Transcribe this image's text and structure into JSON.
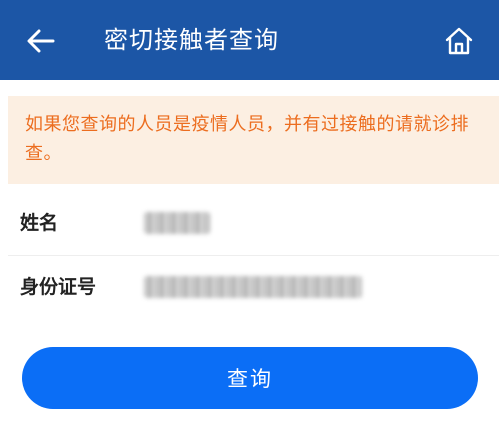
{
  "header": {
    "title": "密切接触者查询",
    "back_icon": "arrow-left-icon",
    "home_icon": "home-icon",
    "background_color": "#1c56a6"
  },
  "notice": {
    "text": "如果您查询的人员是疫情人员，并有过接触的请就诊排查。",
    "text_color": "#ec6d1f",
    "background_color": "#fcefe2"
  },
  "form": {
    "name_label": "姓名",
    "id_label": "身份证号"
  },
  "query_button": {
    "label": "查询",
    "color": "#0b6ef6"
  }
}
